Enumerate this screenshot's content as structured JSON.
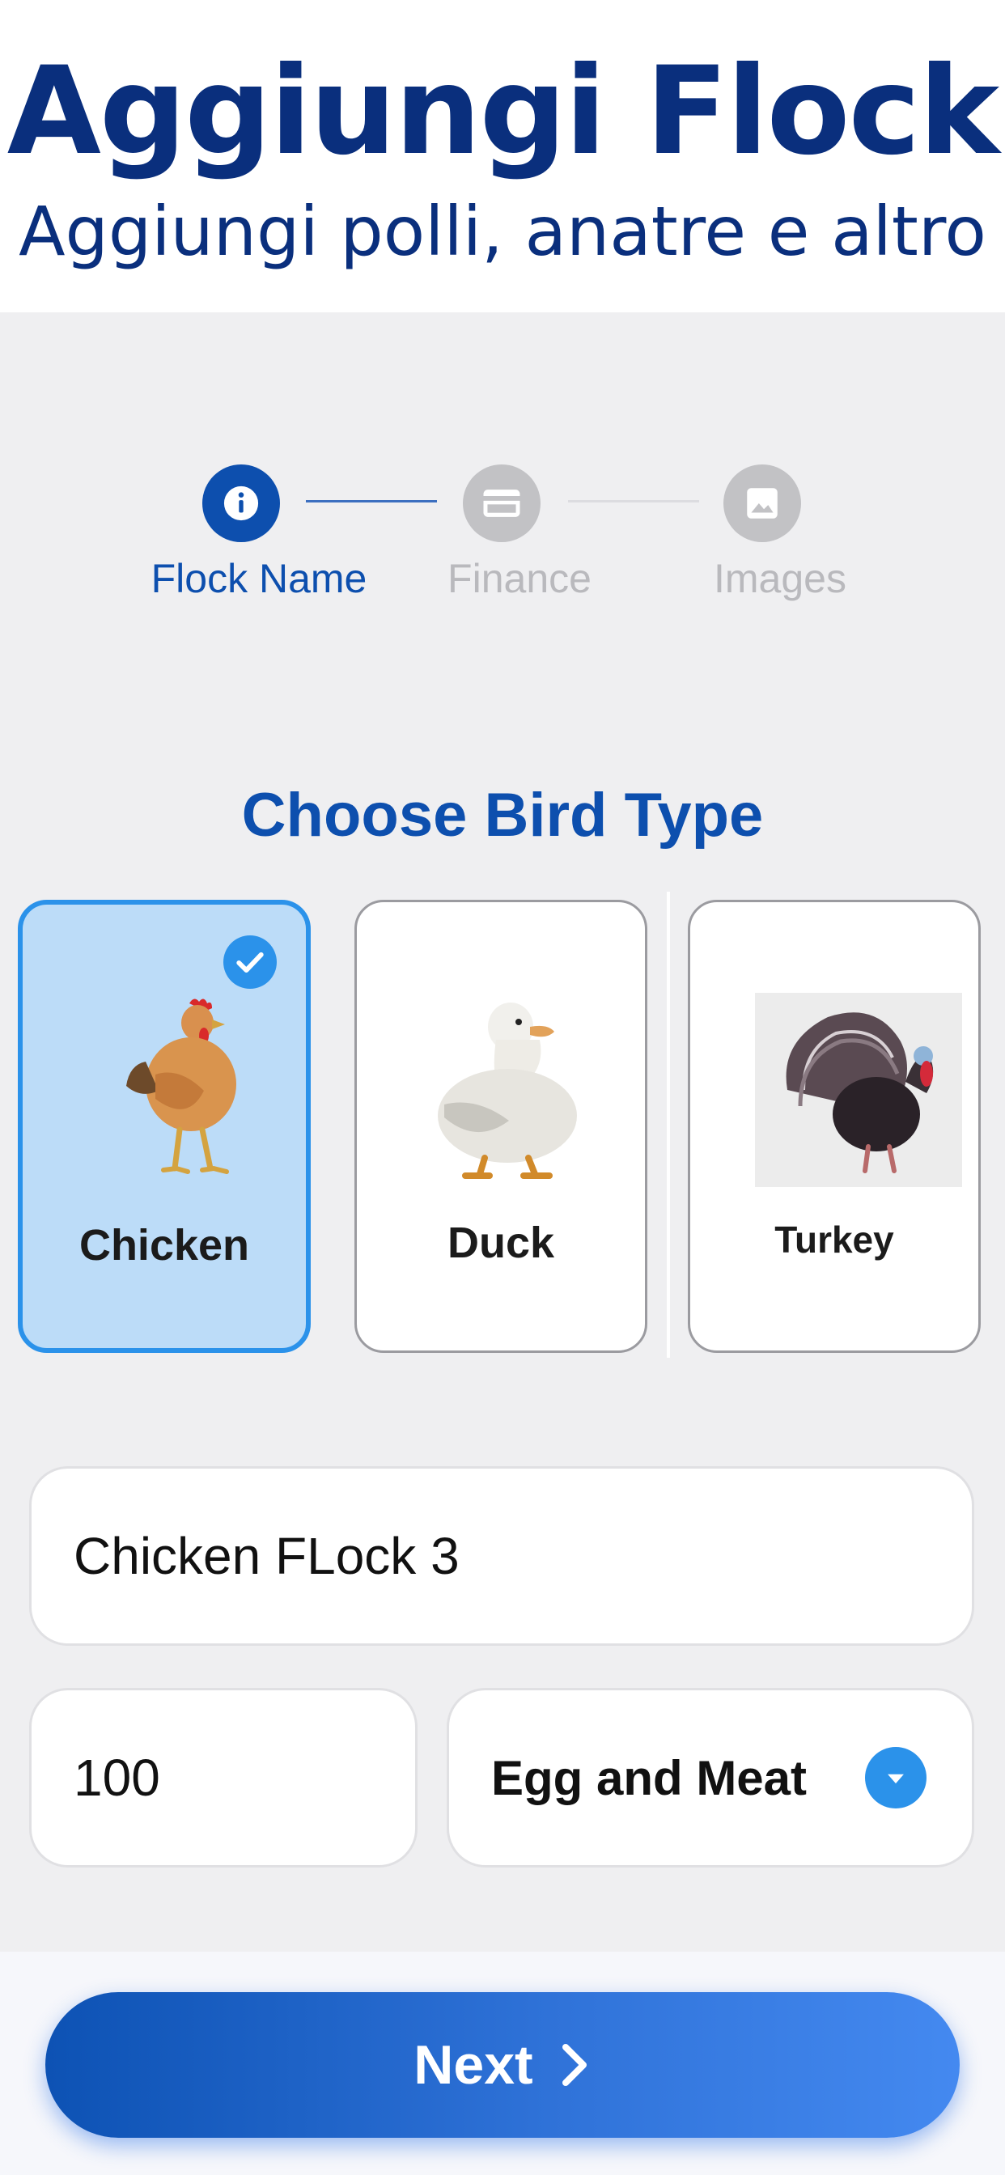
{
  "header": {
    "title": "Aggiungi Flock",
    "subtitle": "Aggiungi polli, anatre e altro"
  },
  "stepper": {
    "steps": [
      {
        "label": "Flock Name",
        "icon": "info-icon",
        "state": "active"
      },
      {
        "label": "Finance",
        "icon": "card-icon",
        "state": "inactive"
      },
      {
        "label": "Images",
        "icon": "image-icon",
        "state": "inactive"
      }
    ]
  },
  "section_title": "Choose Bird Type",
  "birds": [
    {
      "name": "Chicken",
      "selected": true
    },
    {
      "name": "Duck",
      "selected": false
    },
    {
      "name": "Turkey",
      "selected": false
    }
  ],
  "form": {
    "flock_name": "Chicken FLock 3",
    "quantity": "100",
    "purpose": "Egg and Meat"
  },
  "next_button": {
    "label": "Next"
  },
  "colors": {
    "primary": "#0d4fae",
    "accent": "#2b92ea",
    "selected_card": "#bcdcf8",
    "title": "#0a2f7d"
  }
}
